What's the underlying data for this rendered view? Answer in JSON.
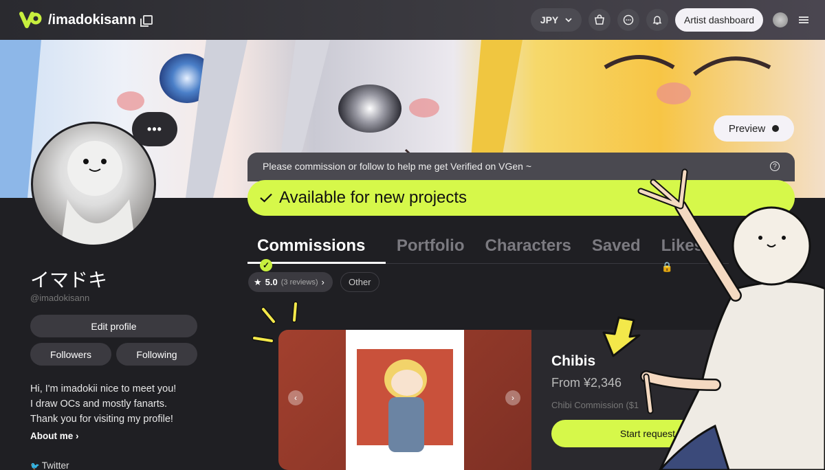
{
  "nav": {
    "handle": "/imadokisann",
    "currency": "JPY",
    "artist_dashboard": "Artist dashboard"
  },
  "banner": {
    "preview_label": "Preview"
  },
  "profile": {
    "bubble": "•••",
    "display_name": "イマドキ",
    "handle": "@imadokisann",
    "edit_profile": "Edit profile",
    "followers": "Followers",
    "following": "Following",
    "bio_lines": [
      "Hi, I'm imadokii nice to meet you!",
      "I draw OCs and mostly fanarts.",
      "Thank you for visiting my profile!"
    ],
    "about_me": "About me",
    "twitter": "Twitter"
  },
  "main": {
    "notice": "Please commission or follow to help me get Verified on VGen ~",
    "availability": "Available for new projects",
    "tabs": [
      "Commissions",
      "Portfolio",
      "Characters",
      "Saved",
      "Likes"
    ],
    "rating_value": "5.0",
    "rating_reviews": "(3 reviews)",
    "other_filter": "Other"
  },
  "card": {
    "title": "Chibis",
    "price": "From ¥2,346",
    "subtitle": "Chibi Commission ($1",
    "start_request": "Start request"
  },
  "colors": {
    "accent": "#d6f84a",
    "background": "#1f1f23",
    "surface": "#3b3a40"
  },
  "icons": [
    "vgen-logo-icon",
    "copy-icon",
    "chevron-down-icon",
    "cart-icon",
    "chat-icon",
    "bell-icon",
    "menu-icon",
    "help-icon",
    "check-icon",
    "verified-icon",
    "star-icon",
    "chevron-right-icon",
    "chevron-left-icon",
    "twitter-icon",
    "lock-icon"
  ]
}
